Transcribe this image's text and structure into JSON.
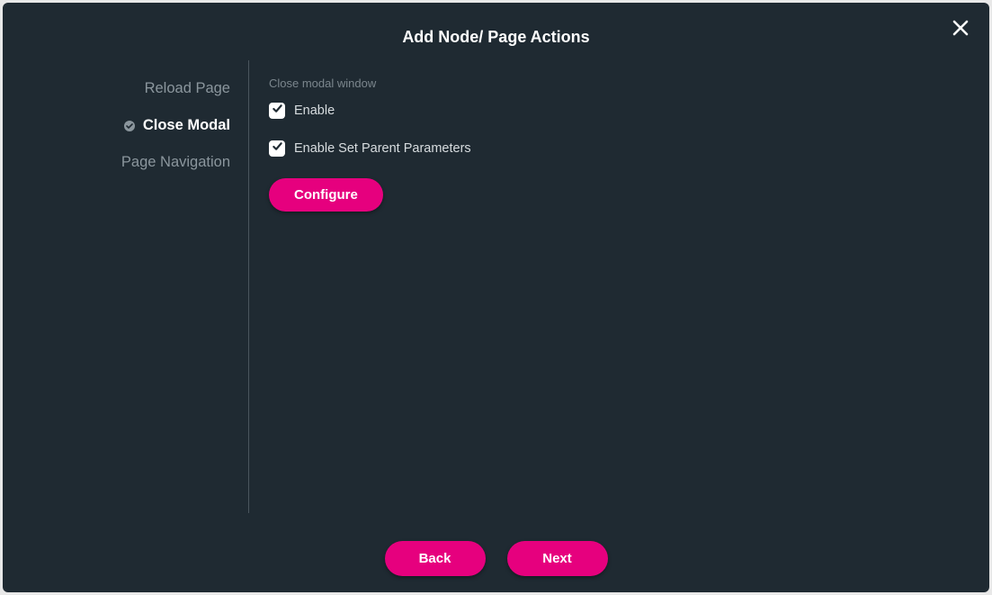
{
  "modal": {
    "title": "Add Node/ Page Actions"
  },
  "sidebar": {
    "items": [
      {
        "label": "Reload Page",
        "selected": false
      },
      {
        "label": "Close Modal",
        "selected": true
      },
      {
        "label": "Page Navigation",
        "selected": false
      }
    ]
  },
  "content": {
    "section_label": "Close modal window",
    "enable_label": "Enable",
    "enable_parent_label": "Enable Set Parent Parameters",
    "configure_label": "Configure"
  },
  "footer": {
    "back_label": "Back",
    "next_label": "Next"
  },
  "colors": {
    "accent": "#e6007e",
    "bg": "#1f2a32"
  }
}
